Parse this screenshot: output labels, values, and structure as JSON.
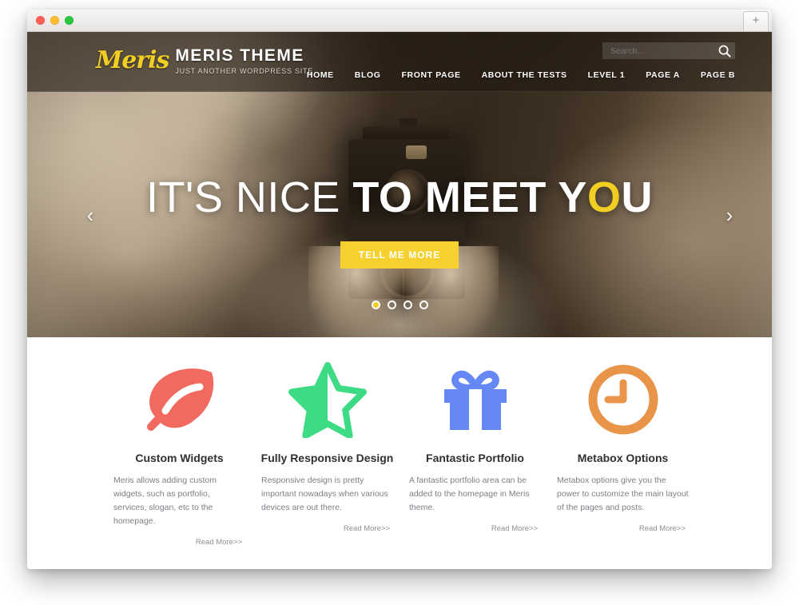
{
  "browser": {
    "traffic_lights": [
      "close",
      "minimize",
      "zoom"
    ],
    "new_tab_label": "+"
  },
  "site": {
    "brand_mark": "Meris",
    "brand_title": "MERIS THEME",
    "brand_tagline": "JUST ANOTHER WORDPRESS SITE",
    "colors": {
      "accent_yellow": "#F2CE23",
      "button_yellow": "#F5D02E",
      "header_overlay": "#201911",
      "heading_dark": "#2F3033",
      "body_grey": "#7C7F85"
    }
  },
  "search": {
    "placeholder": "Search...",
    "value": "",
    "icon": "search-icon"
  },
  "nav": {
    "items": [
      {
        "label": "HOME"
      },
      {
        "label": "BLOG"
      },
      {
        "label": "FRONT PAGE"
      },
      {
        "label": "ABOUT THE TESTS"
      },
      {
        "label": "LEVEL 1"
      },
      {
        "label": "PAGE A"
      },
      {
        "label": "PAGE B"
      }
    ]
  },
  "hero": {
    "headline_part1": "IT'S NICE ",
    "headline_part2": "TO MEET Y",
    "headline_accent": "O",
    "headline_part3": "U",
    "cta_label": "TELL ME MORE",
    "prev_icon": "chevron-left-icon",
    "next_icon": "chevron-right-icon",
    "slide_count": 4,
    "active_slide": 1
  },
  "features": [
    {
      "icon": "leaf-icon",
      "icon_color": "#F2695F",
      "title": "Custom Widgets",
      "text": "Meris allows adding custom widgets, such as portfolio, services, slogan, etc to the homepage.",
      "more_label": "Read More>>"
    },
    {
      "icon": "half-star-icon",
      "icon_color": "#3DDC84",
      "title": "Fully Responsive Design",
      "text": "Responsive design is pretty important nowadays when various devices are out there.",
      "more_label": "Read More>>"
    },
    {
      "icon": "gift-icon",
      "icon_color": "#6688F5",
      "title": "Fantastic Portfolio",
      "text": "A fantastic portfolio area can be added to the homepage in Meris theme.",
      "more_label": "Read More>>"
    },
    {
      "icon": "clock-icon",
      "icon_color": "#E8954A",
      "title": "Metabox Options",
      "text": "Metabox options give you the power to customize the main layout of the pages and posts.",
      "more_label": "Read More>>"
    }
  ]
}
